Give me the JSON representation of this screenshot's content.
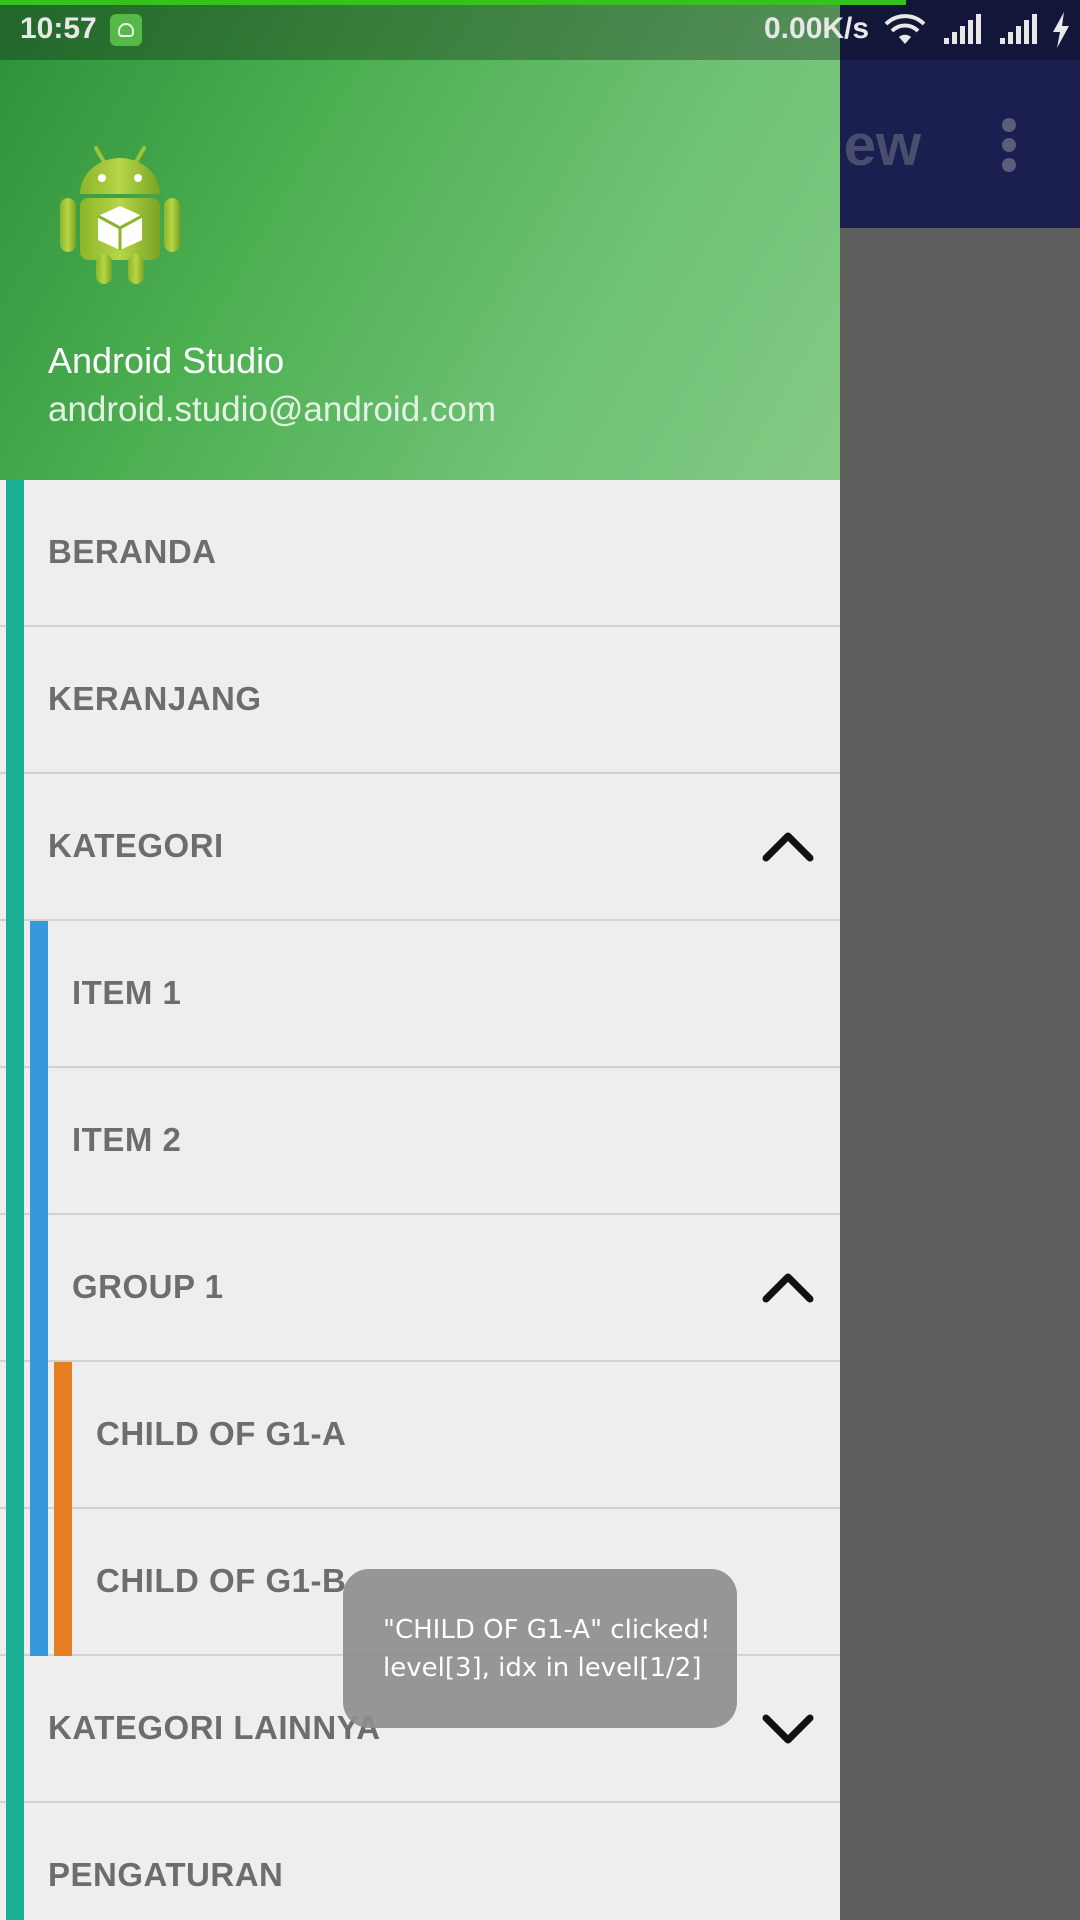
{
  "status_bar": {
    "time": "10:57",
    "net_speed": "0.00K/s",
    "icons": [
      "app-notification-icon",
      "wifi-icon",
      "signal-icon",
      "signal-icon",
      "charging-icon"
    ]
  },
  "background_app": {
    "title_fragment": "View",
    "menu_icon": "overflow-menu-icon"
  },
  "drawer": {
    "header": {
      "logo": "android-logo",
      "name": "Android Studio",
      "email": "android.studio@android.com"
    },
    "items": [
      {
        "label": "BERANDA",
        "level": 1
      },
      {
        "label": "KERANJANG",
        "level": 1
      },
      {
        "label": "KATEGORI",
        "level": 1,
        "chevron": "chevron-up-icon"
      },
      {
        "label": "ITEM 1",
        "level": 2
      },
      {
        "label": "ITEM 2",
        "level": 2
      },
      {
        "label": "GROUP 1",
        "level": 2,
        "chevron": "chevron-up-icon"
      },
      {
        "label": "CHILD OF G1-A",
        "level": 3
      },
      {
        "label": "CHILD OF G1-B",
        "level": 3
      },
      {
        "label": "KATEGORI LAINNYA",
        "level": 1,
        "chevron": "chevron-down-icon"
      },
      {
        "label": "PENGATURAN",
        "level": 1
      }
    ],
    "colors": {
      "level1_bar": "#1aaf94",
      "level2_bar": "#3498db",
      "level3_bar": "#e67e22",
      "header_green": "#4caf50"
    }
  },
  "toast": {
    "line1": "\"CHILD OF G1-A\" clicked!",
    "line2": "level[3], idx in level[1/2]"
  }
}
